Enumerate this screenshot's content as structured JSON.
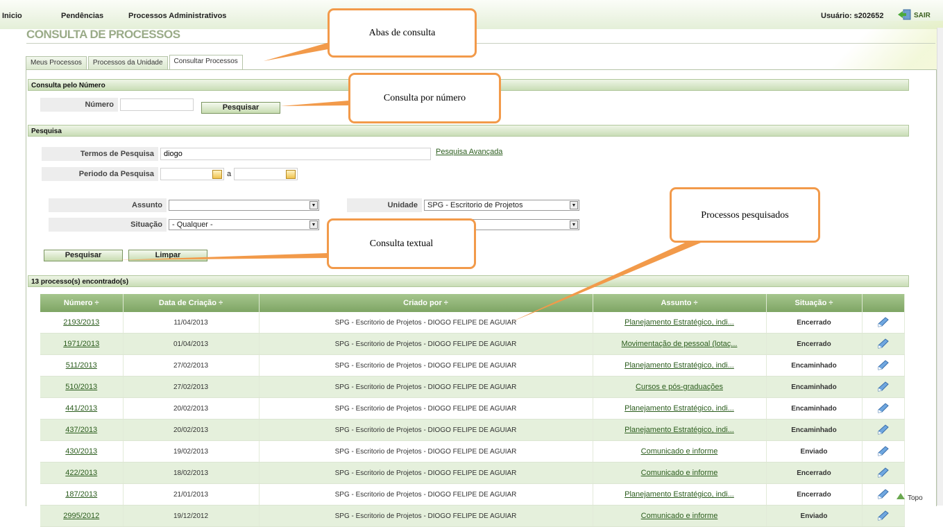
{
  "nav": {
    "inicio": "Inicio",
    "pendencias": "Pendências",
    "processos_adm": "Processos Administrativos"
  },
  "user": "Usuário: s202652",
  "exit": "SAIR",
  "page_title": "CONSULTA DE PROCESSOS",
  "tabs": [
    "Meus Processos",
    "Processos da Unidade",
    "Consultar Processos"
  ],
  "sec_numero": {
    "title": "Consulta pelo Número",
    "label": "Número",
    "value": "",
    "button": "Pesquisar"
  },
  "sec_pesquisa": {
    "title": "Pesquisa",
    "termos_label": "Termos de Pesquisa",
    "termos_value": "diogo",
    "avancada": "Pesquisa Avançada",
    "periodo_label": "Periodo da Pesquisa",
    "periodo_sep": "a",
    "assunto_label": "Assunto",
    "assunto_value": "",
    "unidade_label": "Unidade",
    "unidade_value": "SPG - Escritorio de Projetos",
    "situacao_label": "Situação",
    "situacao_value": "- Qualquer -",
    "pesquisar": "Pesquisar",
    "limpar": "Limpar"
  },
  "results": {
    "title": "13 processo(s) encontrado(s)",
    "columns": [
      "Número ÷",
      "Data de Criação ÷",
      "Criado por ÷",
      "Assunto ÷",
      "Situação ÷",
      ""
    ],
    "rows": [
      [
        "2193/2013",
        "11/04/2013",
        "SPG - Escritorio de Projetos - DIOGO FELIPE DE AGUIAR",
        "Planejamento Estratégico, indi...",
        "Encerrado"
      ],
      [
        "1971/2013",
        "01/04/2013",
        "SPG - Escritorio de Projetos - DIOGO FELIPE DE AGUIAR",
        "Movimentação de pessoal (lotaç...",
        "Encerrado"
      ],
      [
        "511/2013",
        "27/02/2013",
        "SPG - Escritorio de Projetos - DIOGO FELIPE DE AGUIAR",
        "Planejamento Estratégico, indi...",
        "Encaminhado"
      ],
      [
        "510/2013",
        "27/02/2013",
        "SPG - Escritorio de Projetos - DIOGO FELIPE DE AGUIAR",
        "Cursos e pós-graduações",
        "Encaminhado"
      ],
      [
        "441/2013",
        "20/02/2013",
        "SPG - Escritorio de Projetos - DIOGO FELIPE DE AGUIAR",
        "Planejamento Estratégico, indi...",
        "Encaminhado"
      ],
      [
        "437/2013",
        "20/02/2013",
        "SPG - Escritorio de Projetos - DIOGO FELIPE DE AGUIAR",
        "Planejamento Estratégico, indi...",
        "Encaminhado"
      ],
      [
        "430/2013",
        "19/02/2013",
        "SPG - Escritorio de Projetos - DIOGO FELIPE DE AGUIAR",
        "Comunicado e informe",
        "Enviado"
      ],
      [
        "422/2013",
        "18/02/2013",
        "SPG - Escritorio de Projetos - DIOGO FELIPE DE AGUIAR",
        "Comunicado e informe",
        "Encerrado"
      ],
      [
        "187/2013",
        "21/01/2013",
        "SPG - Escritorio de Projetos - DIOGO FELIPE DE AGUIAR",
        "Planejamento Estratégico, indi...",
        "Encerrado"
      ],
      [
        "2995/2012",
        "19/12/2012",
        "SPG - Escritorio de Projetos - DIOGO FELIPE DE AGUIAR",
        "Comunicado e informe",
        "Enviado"
      ]
    ]
  },
  "callouts": {
    "abas": "Abas de consulta",
    "numero": "Consulta por número",
    "textual": "Consulta textual",
    "processos": "Processos pesquisados"
  },
  "topo": "Topo",
  "colors": {
    "accent": "#7ea564",
    "callout": "#f29a4a",
    "link": "#2a5c1c"
  },
  "icons": {
    "exit": "exit-icon",
    "calendar": "calendar-icon",
    "edit": "edit-icon",
    "topo": "arrow-up-icon"
  }
}
